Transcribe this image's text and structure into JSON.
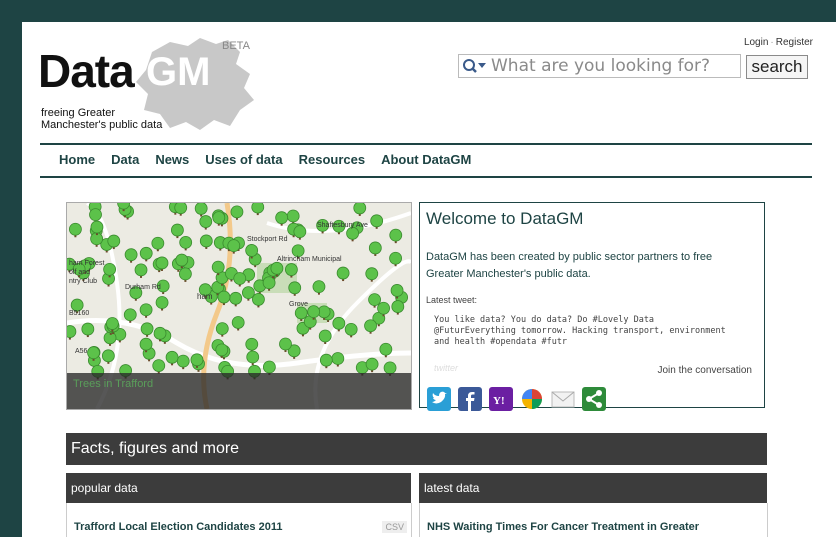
{
  "header": {
    "logo_data": "Data",
    "logo_gm": "GM",
    "beta": "BETA",
    "tagline_line1": "freeing Greater",
    "tagline_line2": "Manchester's public data",
    "login": "Login",
    "separator": "·",
    "register": "Register",
    "search_placeholder": "What are you looking for?",
    "search_button": "search"
  },
  "nav": {
    "items": [
      "Home",
      "Data",
      "News",
      "Uses of data",
      "Resources",
      "About DataGM"
    ]
  },
  "feature": {
    "map_caption": "Trees in Trafford",
    "map_labels": [
      "Altrincham Municipal",
      "Grove",
      "Stockport Rd",
      "Shaftesbury Ave",
      "Durham Rd",
      "ham",
      "ham Forest",
      "olf and",
      "ntry Club",
      "B5160",
      "A56"
    ]
  },
  "welcome": {
    "title": "Welcome to DataGM",
    "intro": "DataGM has been created by public sector partners to free Greater Manchester's public data.",
    "tweet_label": "Latest tweet:",
    "tweet": "You like data? You do data? Do #Lovely Data @FuturEverything tomorrow. Hacking transport, environment and health #opendata #futr",
    "powered": "twitter",
    "join": "Join the conversation",
    "social_icons": [
      "twitter-icon",
      "facebook-icon",
      "yahoo-icon",
      "google-buzz-icon",
      "email-icon",
      "share-icon"
    ],
    "colors": {
      "twitter": "#2a9fd6",
      "facebook": "#3b5998",
      "yahoo": "#6b1fa2",
      "share": "#2e8b3a"
    }
  },
  "facts": {
    "heading": "Facts, figures and more",
    "popular_heading": "popular data",
    "latest_heading": "latest data",
    "popular_item": "Trafford Local Election Candidates 2011",
    "popular_badge": "CSV",
    "latest_item": "NHS Waiting Times For Cancer Treatment in Greater"
  },
  "colors": {
    "accent": "#1e4444",
    "dark_bar": "#3c3c3c",
    "tree_green": "#5cc24a"
  }
}
